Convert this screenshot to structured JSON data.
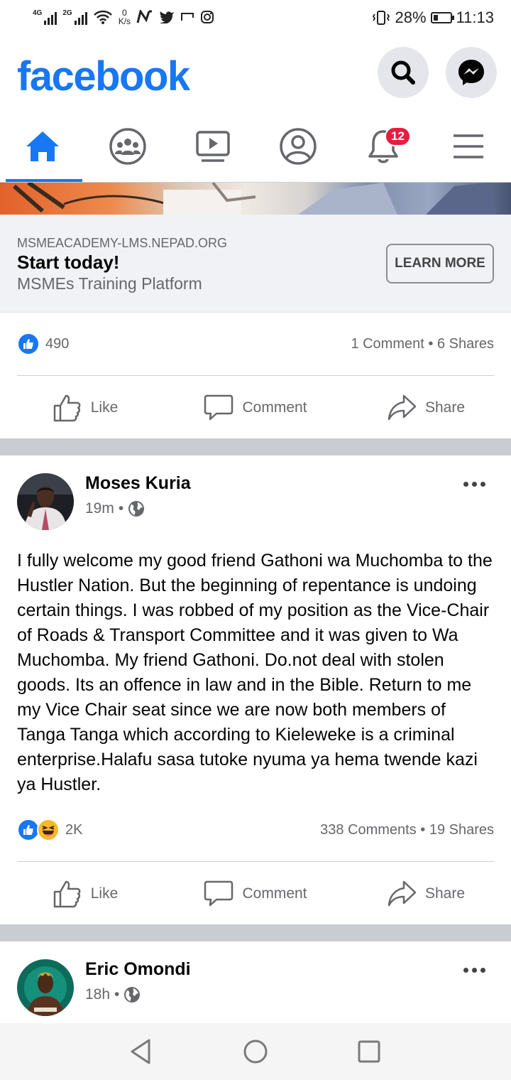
{
  "status_bar": {
    "net1": "4G",
    "net2": "2G",
    "speed_value": "0",
    "speed_unit": "K/s",
    "battery": "28%",
    "battery_level": 0.28,
    "time": "11:13"
  },
  "header": {
    "logo": "facebook",
    "icons": [
      "search-icon",
      "messenger-icon"
    ]
  },
  "nav": {
    "tabs": [
      "home",
      "groups",
      "watch",
      "profile",
      "notifications",
      "menu"
    ],
    "active": "home",
    "notification_count": "12"
  },
  "ad": {
    "domain": "MSMEACADEMY-LMS.NEPAD.ORG",
    "title": "Start today!",
    "subtitle": "MSMEs Training Platform",
    "cta": "LEARN MORE",
    "reaction_count": "490",
    "comments": "1 Comment",
    "shares": "6 Shares"
  },
  "actions": {
    "like": "Like",
    "comment": "Comment",
    "share": "Share"
  },
  "post1": {
    "author": "Moses Kuria",
    "time": "19m",
    "text": "I fully welcome my good friend Gathoni wa Muchomba to the Hustler Nation. But the beginning of repentance is undoing certain things. I was robbed of my position as the Vice-Chair of Roads & Transport Committee and it was given to Wa Muchomba. My friend Gathoni. Do.not deal with stolen goods. Its an offence in law and in the Bible. Return to me my Vice Chair seat since we are now both members of Tanga Tanga which according to Kieleweke is a criminal enterprise.Halafu sasa tutoke nyuma ya hema twende kazi ya Hustler.",
    "reaction_count": "2K",
    "comments": "338 Comments",
    "shares": "19 Shares"
  },
  "post2": {
    "author": "Eric Omondi",
    "time": "18h"
  },
  "colors": {
    "brand": "#1877f2",
    "badge": "#e41e3f",
    "muted": "#65676b"
  }
}
